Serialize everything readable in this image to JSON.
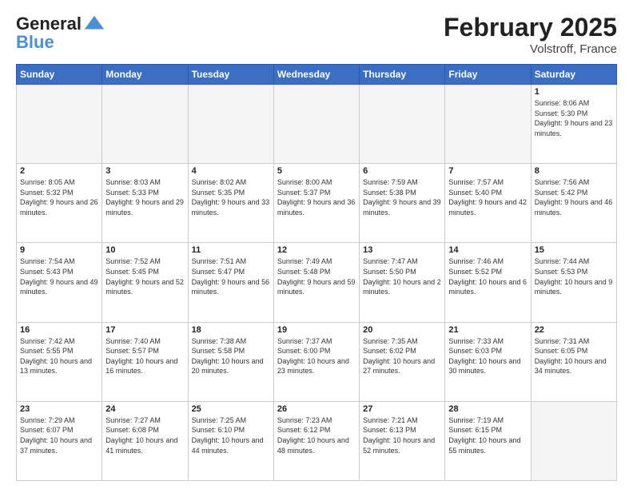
{
  "header": {
    "logo_general": "General",
    "logo_blue": "Blue",
    "month": "February 2025",
    "location": "Volstroff, France"
  },
  "weekdays": [
    "Sunday",
    "Monday",
    "Tuesday",
    "Wednesday",
    "Thursday",
    "Friday",
    "Saturday"
  ],
  "weeks": [
    [
      {
        "day": "",
        "info": ""
      },
      {
        "day": "",
        "info": ""
      },
      {
        "day": "",
        "info": ""
      },
      {
        "day": "",
        "info": ""
      },
      {
        "day": "",
        "info": ""
      },
      {
        "day": "",
        "info": ""
      },
      {
        "day": "1",
        "info": "Sunrise: 8:06 AM\nSunset: 5:30 PM\nDaylight: 9 hours and 23 minutes."
      }
    ],
    [
      {
        "day": "2",
        "info": "Sunrise: 8:05 AM\nSunset: 5:32 PM\nDaylight: 9 hours and 26 minutes."
      },
      {
        "day": "3",
        "info": "Sunrise: 8:03 AM\nSunset: 5:33 PM\nDaylight: 9 hours and 29 minutes."
      },
      {
        "day": "4",
        "info": "Sunrise: 8:02 AM\nSunset: 5:35 PM\nDaylight: 9 hours and 33 minutes."
      },
      {
        "day": "5",
        "info": "Sunrise: 8:00 AM\nSunset: 5:37 PM\nDaylight: 9 hours and 36 minutes."
      },
      {
        "day": "6",
        "info": "Sunrise: 7:59 AM\nSunset: 5:38 PM\nDaylight: 9 hours and 39 minutes."
      },
      {
        "day": "7",
        "info": "Sunrise: 7:57 AM\nSunset: 5:40 PM\nDaylight: 9 hours and 42 minutes."
      },
      {
        "day": "8",
        "info": "Sunrise: 7:56 AM\nSunset: 5:42 PM\nDaylight: 9 hours and 46 minutes."
      }
    ],
    [
      {
        "day": "9",
        "info": "Sunrise: 7:54 AM\nSunset: 5:43 PM\nDaylight: 9 hours and 49 minutes."
      },
      {
        "day": "10",
        "info": "Sunrise: 7:52 AM\nSunset: 5:45 PM\nDaylight: 9 hours and 52 minutes."
      },
      {
        "day": "11",
        "info": "Sunrise: 7:51 AM\nSunset: 5:47 PM\nDaylight: 9 hours and 56 minutes."
      },
      {
        "day": "12",
        "info": "Sunrise: 7:49 AM\nSunset: 5:48 PM\nDaylight: 9 hours and 59 minutes."
      },
      {
        "day": "13",
        "info": "Sunrise: 7:47 AM\nSunset: 5:50 PM\nDaylight: 10 hours and 2 minutes."
      },
      {
        "day": "14",
        "info": "Sunrise: 7:46 AM\nSunset: 5:52 PM\nDaylight: 10 hours and 6 minutes."
      },
      {
        "day": "15",
        "info": "Sunrise: 7:44 AM\nSunset: 5:53 PM\nDaylight: 10 hours and 9 minutes."
      }
    ],
    [
      {
        "day": "16",
        "info": "Sunrise: 7:42 AM\nSunset: 5:55 PM\nDaylight: 10 hours and 13 minutes."
      },
      {
        "day": "17",
        "info": "Sunrise: 7:40 AM\nSunset: 5:57 PM\nDaylight: 10 hours and 16 minutes."
      },
      {
        "day": "18",
        "info": "Sunrise: 7:38 AM\nSunset: 5:58 PM\nDaylight: 10 hours and 20 minutes."
      },
      {
        "day": "19",
        "info": "Sunrise: 7:37 AM\nSunset: 6:00 PM\nDaylight: 10 hours and 23 minutes."
      },
      {
        "day": "20",
        "info": "Sunrise: 7:35 AM\nSunset: 6:02 PM\nDaylight: 10 hours and 27 minutes."
      },
      {
        "day": "21",
        "info": "Sunrise: 7:33 AM\nSunset: 6:03 PM\nDaylight: 10 hours and 30 minutes."
      },
      {
        "day": "22",
        "info": "Sunrise: 7:31 AM\nSunset: 6:05 PM\nDaylight: 10 hours and 34 minutes."
      }
    ],
    [
      {
        "day": "23",
        "info": "Sunrise: 7:29 AM\nSunset: 6:07 PM\nDaylight: 10 hours and 37 minutes."
      },
      {
        "day": "24",
        "info": "Sunrise: 7:27 AM\nSunset: 6:08 PM\nDaylight: 10 hours and 41 minutes."
      },
      {
        "day": "25",
        "info": "Sunrise: 7:25 AM\nSunset: 6:10 PM\nDaylight: 10 hours and 44 minutes."
      },
      {
        "day": "26",
        "info": "Sunrise: 7:23 AM\nSunset: 6:12 PM\nDaylight: 10 hours and 48 minutes."
      },
      {
        "day": "27",
        "info": "Sunrise: 7:21 AM\nSunset: 6:13 PM\nDaylight: 10 hours and 52 minutes."
      },
      {
        "day": "28",
        "info": "Sunrise: 7:19 AM\nSunset: 6:15 PM\nDaylight: 10 hours and 55 minutes."
      },
      {
        "day": "",
        "info": ""
      }
    ]
  ]
}
